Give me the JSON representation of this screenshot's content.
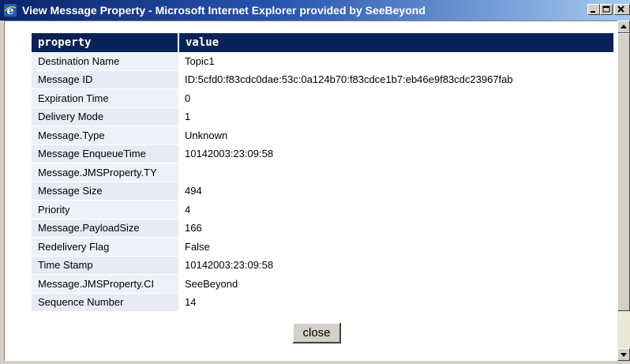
{
  "window": {
    "title": "View Message Property - Microsoft Internet Explorer provided by SeeBeyond",
    "icon": "internet-explorer-icon"
  },
  "table": {
    "headers": {
      "property": "property",
      "value": "value"
    },
    "rows": [
      {
        "property": "Destination Name",
        "value": "Topic1"
      },
      {
        "property": "Message ID",
        "value": "ID:5cfd0:f83cdc0dae:53c:0a124b70:f83cdce1b7:eb46e9f83cdc23967fab"
      },
      {
        "property": "Expiration Time",
        "value": "0"
      },
      {
        "property": "Delivery Mode",
        "value": "1"
      },
      {
        "property": "Message.Type",
        "value": "Unknown"
      },
      {
        "property": "Message EnqueueTime",
        "value": "10142003:23:09:58"
      },
      {
        "property": "Message.JMSProperty.TY",
        "value": ""
      },
      {
        "property": "Message Size",
        "value": "494"
      },
      {
        "property": "Priority",
        "value": "4"
      },
      {
        "property": "Message.PayloadSize",
        "value": "166"
      },
      {
        "property": "Redelivery Flag",
        "value": "False"
      },
      {
        "property": "Time Stamp",
        "value": "10142003:23:09:58"
      },
      {
        "property": "Message.JMSProperty.CI",
        "value": "SeeBeyond"
      },
      {
        "property": "Sequence Number",
        "value": "14"
      }
    ]
  },
  "buttons": {
    "close_label": "close"
  },
  "colors": {
    "header_bg": "#0a2257",
    "titlebar": "#0a246a"
  }
}
